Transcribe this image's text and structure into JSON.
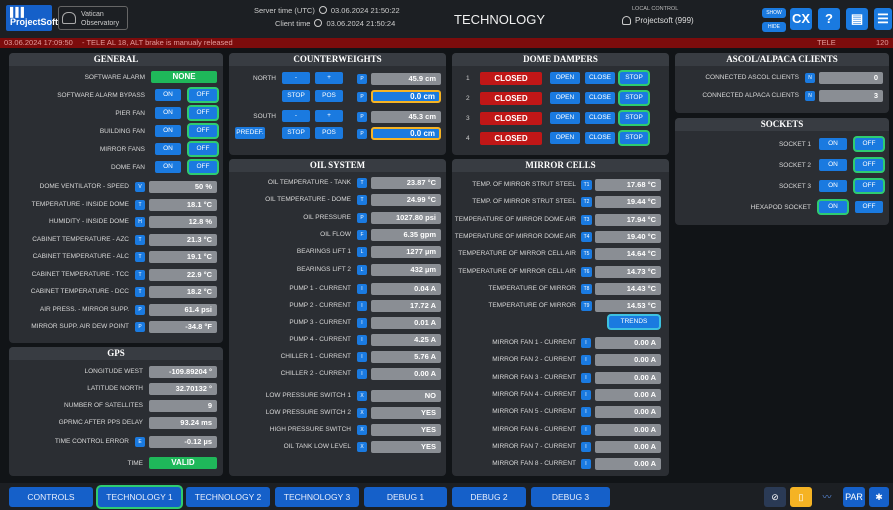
{
  "header": {
    "logo": "ProjectSoft",
    "observatory": "Vatican Observatory",
    "server_time_label": "Server time (UTC)",
    "server_time": "03.06.2024 21:50:22",
    "client_time_label": "Client time",
    "client_time": "03.06.2024 21:50:24",
    "title": "TECHNOLOGY",
    "local_control": "LOCAL CONTROL",
    "user": "Projectsoft (999)",
    "show_label": "SHOW",
    "hide_label": "HIDE",
    "icons": [
      "cx-icon",
      "help-icon",
      "display-icon",
      "list-icon"
    ]
  },
  "alarm": {
    "timestamp": "03.06.2024 17:09:50",
    "message": "- TELE AL 18, ALT brake is manualy released",
    "source": "TELE",
    "count": "120"
  },
  "general": {
    "title": "GENERAL",
    "software_alarm_label": "SOFTWARE ALARM",
    "software_alarm_value": "NONE",
    "toggles": [
      {
        "label": "SOFTWARE ALARM BYPASS",
        "on": "ON",
        "off": "OFF"
      },
      {
        "label": "PIER FAN",
        "on": "ON",
        "off": "OFF"
      },
      {
        "label": "BUILDING FAN",
        "on": "ON",
        "off": "OFF"
      },
      {
        "label": "MIRROR FANS",
        "on": "ON",
        "off": "OFF"
      },
      {
        "label": "DOME FAN",
        "on": "ON",
        "off": "OFF"
      }
    ],
    "readings": [
      {
        "label": "DOME VENTILATOR - SPEED",
        "tag": "V",
        "value": "50 %"
      },
      {
        "label": "TEMPERATURE - INSIDE DOME",
        "tag": "T",
        "value": "18.1 °C"
      },
      {
        "label": "HUMIDITY - INSIDE DOME",
        "tag": "H",
        "value": "12.8 %"
      },
      {
        "label": "CABINET TEMPERATURE - AZC",
        "tag": "T",
        "value": "21.3 °C"
      },
      {
        "label": "CABINET TEMPERATURE - ALC",
        "tag": "T",
        "value": "19.1 °C"
      },
      {
        "label": "CABINET TEMPERATURE - TCC",
        "tag": "T",
        "value": "22.9 °C"
      },
      {
        "label": "CABINET TEMPERATURE - DCC",
        "tag": "T",
        "value": "18.2 °C"
      },
      {
        "label": "AIR PRESS. - MIRROR SUPP.",
        "tag": "P",
        "value": "61.4 psi"
      },
      {
        "label": "MIRROR SUPP. AIR DEW POINT",
        "tag": "P",
        "value": "-34.8 °F"
      }
    ]
  },
  "gps": {
    "title": "GPS",
    "readings": [
      {
        "label": "LONGITUDE WEST",
        "value": "-109.89204 °"
      },
      {
        "label": "LATITUDE NORTH",
        "value": "32.70132 °"
      },
      {
        "label": "NUMBER OF SATELLITES",
        "value": "9"
      },
      {
        "label": "GPRMC AFTER PPS DELAY",
        "value": "93.24 ms"
      }
    ],
    "time_control_error_label": "TIME CONTROL ERROR",
    "time_control_error_tag": "E",
    "time_control_error_value": "-0.12 µs",
    "time_label": "TIME",
    "time_value": "VALID"
  },
  "counterweights": {
    "title": "COUNTERWEIGHTS",
    "north_label": "NORTH",
    "south_label": "SOUTH",
    "minus": "-",
    "plus": "+",
    "p_tag": "P",
    "stop": "STOP",
    "pos": "POS",
    "predef": "PREDEF.",
    "north_value": "45.9 cm",
    "north_target": "0.0 cm",
    "south_value": "45.3 cm",
    "south_target": "0.0 cm"
  },
  "oil": {
    "title": "OIL SYSTEM",
    "readings": [
      {
        "label": "OIL TEMPERATURE - TANK",
        "tag": "T",
        "value": "23.87 °C"
      },
      {
        "label": "OIL TEMPERATURE - DOME",
        "tag": "T",
        "value": "24.99 °C"
      },
      {
        "label": "OIL PRESSURE",
        "tag": "P",
        "value": "1027.80 psi"
      },
      {
        "label": "OIL FLOW",
        "tag": "F",
        "value": "6.35 gpm"
      },
      {
        "label": "BEARINGS LIFT 1",
        "tag": "L",
        "value": "1277 µm"
      },
      {
        "label": "BEARINGS LIFT 2",
        "tag": "L",
        "value": "432 µm"
      }
    ],
    "currents": [
      {
        "label": "PUMP 1 - CURRENT",
        "tag": "I",
        "value": "0.04 A"
      },
      {
        "label": "PUMP 2 - CURRENT",
        "tag": "I",
        "value": "17.72 A"
      },
      {
        "label": "PUMP 3 - CURRENT",
        "tag": "I",
        "value": "0.01 A"
      },
      {
        "label": "PUMP 4 - CURRENT",
        "tag": "I",
        "value": "4.25 A"
      },
      {
        "label": "CHILLER 1 - CURRENT",
        "tag": "I",
        "value": "5.76 A"
      },
      {
        "label": "CHILLER 2 - CURRENT",
        "tag": "I",
        "value": "0.00 A"
      }
    ],
    "switches": [
      {
        "label": "LOW PRESSURE SWITCH 1",
        "tag": "X",
        "value": "NO"
      },
      {
        "label": "LOW PRESSURE SWITCH 2",
        "tag": "X",
        "value": "YES"
      },
      {
        "label": "HIGH PRESSURE SWITCH",
        "tag": "X",
        "value": "YES"
      },
      {
        "label": "OIL TANK LOW LEVEL",
        "tag": "X",
        "value": "YES"
      }
    ]
  },
  "dampers": {
    "title": "DOME DAMPERS",
    "rows": [
      {
        "num": "1",
        "state": "CLOSED",
        "open": "OPEN",
        "close": "CLOSE",
        "stop": "STOP"
      },
      {
        "num": "2",
        "state": "CLOSED",
        "open": "OPEN",
        "close": "CLOSE",
        "stop": "STOP"
      },
      {
        "num": "3",
        "state": "CLOSED",
        "open": "OPEN",
        "close": "CLOSE",
        "stop": "STOP"
      },
      {
        "num": "4",
        "state": "CLOSED",
        "open": "OPEN",
        "close": "CLOSE",
        "stop": "STOP"
      }
    ]
  },
  "mirror": {
    "title": "MIRROR CELLS",
    "readings": [
      {
        "label": "TEMP. OF MIRROR STRUT STEEL",
        "tag": "T1",
        "value": "17.68 °C"
      },
      {
        "label": "TEMP. OF MIRROR STRUT STEEL",
        "tag": "T2",
        "value": "19.44 °C"
      },
      {
        "label": "TEMPERATURE OF MIRROR DOME AIR",
        "tag": "T3",
        "value": "17.94 °C"
      },
      {
        "label": "TEMPERATURE OF MIRROR DOME AIR",
        "tag": "T4",
        "value": "19.40 °C"
      },
      {
        "label": "TEMPERATURE OF MIRROR CELL AIR",
        "tag": "T5",
        "value": "14.64 °C"
      },
      {
        "label": "TEMPERATURE OF MIRROR CELL AIR",
        "tag": "T6",
        "value": "14.73 °C"
      },
      {
        "label": "TEMPERATURE OF MIRROR",
        "tag": "T8",
        "value": "14.43 °C"
      },
      {
        "label": "TEMPERATURE OF MIRROR",
        "tag": "T9",
        "value": "14.53 °C"
      }
    ],
    "trends": "TRENDS",
    "fans": [
      {
        "label": "MIRROR FAN 1 - CURRENT",
        "tag": "I",
        "value": "0.00 A"
      },
      {
        "label": "MIRROR FAN 2 - CURRENT",
        "tag": "I",
        "value": "0.00 A"
      },
      {
        "label": "MIRROR FAN 3 - CURRENT",
        "tag": "I",
        "value": "0.00 A"
      },
      {
        "label": "MIRROR FAN 4 - CURRENT",
        "tag": "I",
        "value": "0.00 A"
      },
      {
        "label": "MIRROR FAN 5 - CURRENT",
        "tag": "I",
        "value": "0.00 A"
      },
      {
        "label": "MIRROR FAN 6 - CURRENT",
        "tag": "I",
        "value": "0.00 A"
      },
      {
        "label": "MIRROR FAN 7 - CURRENT",
        "tag": "I",
        "value": "0.00 A"
      },
      {
        "label": "MIRROR FAN 8 - CURRENT",
        "tag": "I",
        "value": "0.00 A"
      }
    ]
  },
  "ascol": {
    "title": "ASCOL/ALPACA CLIENTS",
    "rows": [
      {
        "label": "CONNECTED ASCOL CLIENTS",
        "tag": "N",
        "value": "0"
      },
      {
        "label": "CONNECTED ALPACA CLIENTS",
        "tag": "N",
        "value": "3"
      }
    ]
  },
  "sockets": {
    "title": "SOCKETS",
    "rows": [
      {
        "label": "SOCKET 1",
        "on": "ON",
        "off": "OFF"
      },
      {
        "label": "SOCKET 2",
        "on": "ON",
        "off": "OFF"
      },
      {
        "label": "SOCKET 3",
        "on": "ON",
        "off": "OFF"
      },
      {
        "label": "HEXAPOD SOCKET",
        "on": "ON",
        "off": "OFF"
      }
    ]
  },
  "tabs": [
    "CONTROLS",
    "TECHNOLOGY 1",
    "TECHNOLOGY 2",
    "TECHNOLOGY 3",
    "DEBUG 1",
    "DEBUG 2",
    "DEBUG 3"
  ],
  "bottom_icons": {
    "par": "PAR",
    "icons": [
      "no-sound-icon",
      "lamp-icon",
      "chart-icon",
      "par-button",
      "settings-icon"
    ]
  },
  "colors": {
    "accent": "#1a7ae0",
    "alarm": "#7c0c0c",
    "ok": "#1fb85a",
    "closed": "#c01717"
  }
}
